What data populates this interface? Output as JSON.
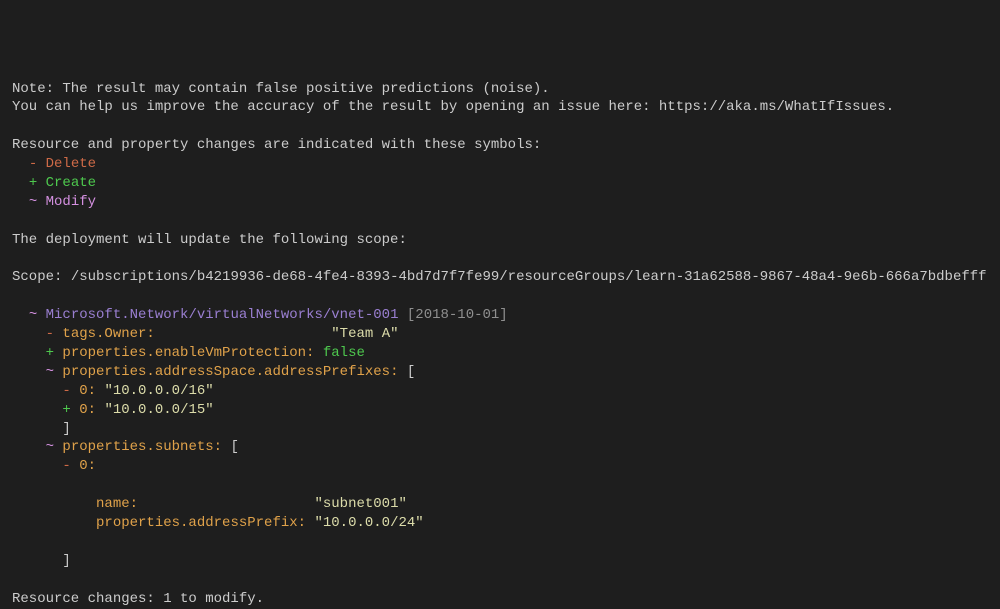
{
  "header": {
    "note": "Note: The result may contain false positive predictions (noise).",
    "improve": "You can help us improve the accuracy of the result by opening an issue here: https://aka.ms/WhatIfIssues.",
    "legend_intro": "Resource and property changes are indicated with these symbols:",
    "legend": {
      "delete_sym": "-",
      "delete_text": "Delete",
      "create_sym": "+",
      "create_text": "Create",
      "modify_sym": "~",
      "modify_text": "Modify"
    },
    "scope_intro": "The deployment will update the following scope:",
    "scope_label": "Scope: ",
    "scope_value": "/subscriptions/b4219936-de68-4fe4-8393-4bd7d7f7fe99/resourceGroups/learn-31a62588-9867-48a4-9e6b-666a7bdbefff"
  },
  "resource": {
    "modify_sym": "~",
    "type": "Microsoft.Network/virtualNetworks/vnet-001",
    "api_version": "[2018-10-01]",
    "lines": {
      "tags_owner_key": "tags.Owner:",
      "tags_owner_val": "\"Team A\"",
      "enable_vm_key": "properties.enableVmProtection:",
      "enable_vm_val": "false",
      "addr_prefixes_key": "properties.addressSpace.addressPrefixes:",
      "bracket_open": "[",
      "bracket_close": "]",
      "idx0_key": "0:",
      "old_prefix": "\"10.0.0.0/16\"",
      "new_prefix": "\"10.0.0.0/15\"",
      "subnets_key": "properties.subnets:",
      "subnet_name_key": "name:",
      "subnet_name_val": "\"subnet001\"",
      "subnet_addr_key": "properties.addressPrefix:",
      "subnet_addr_val": "\"10.0.0.0/24\""
    }
  },
  "footer": {
    "summary": "Resource changes: 1 to modify."
  }
}
